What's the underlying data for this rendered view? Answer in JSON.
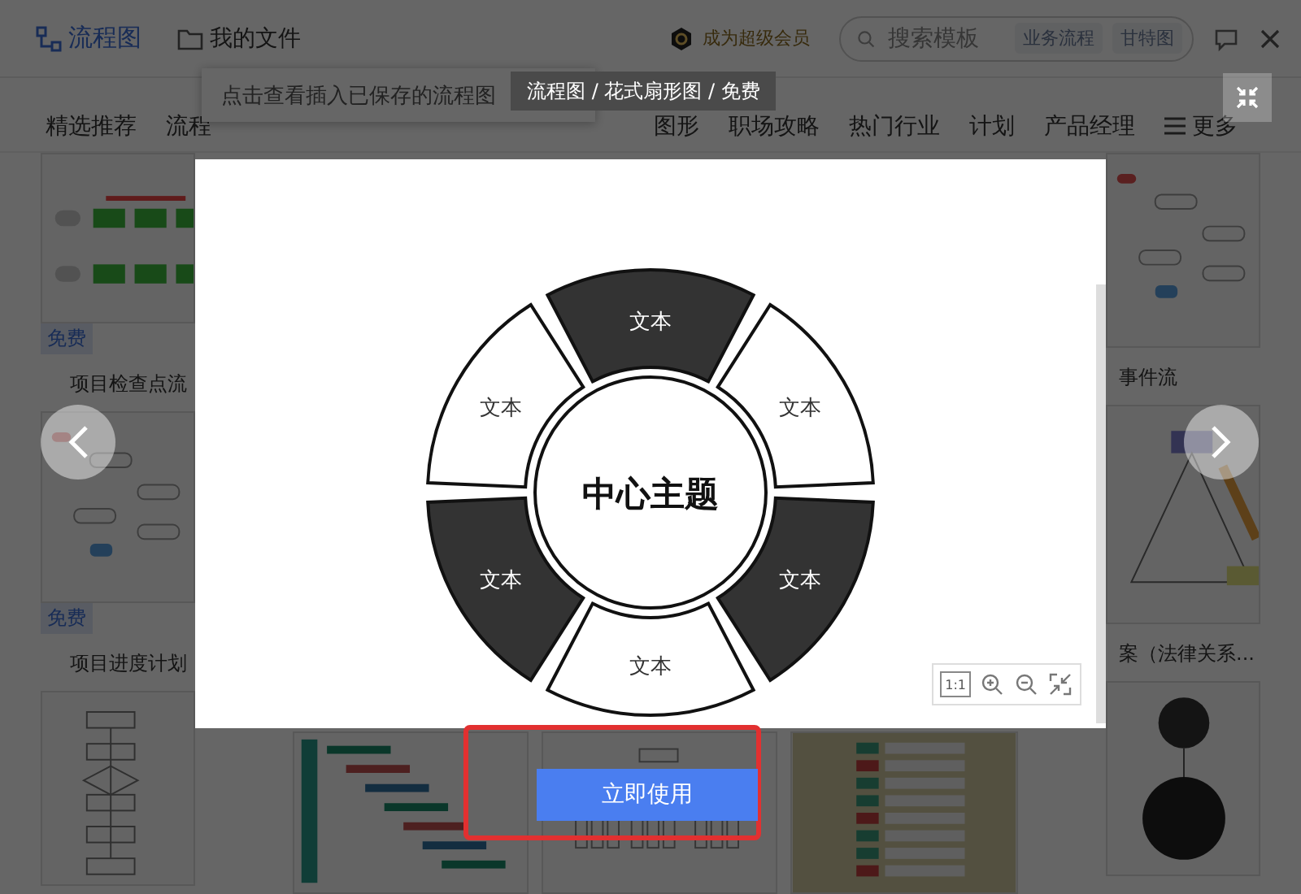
{
  "header": {
    "logo": "流程图",
    "my_files": "我的文件",
    "vip": "成为超级会员",
    "search": {
      "placeholder": "搜索模板",
      "tags": [
        "业务流程",
        "甘特图"
      ]
    }
  },
  "nav": {
    "items_left": [
      "精选推荐",
      "流程"
    ],
    "items_right": [
      "图形",
      "职场攻略",
      "热门行业",
      "计划",
      "产品经理"
    ],
    "more": "更多"
  },
  "tooltip": "点击查看插入已保存的流程图",
  "left_cards": [
    {
      "kind": "green-flow",
      "tag": "免费",
      "title": "项目检查点流"
    },
    {
      "kind": "loop-flow",
      "tag": "免费",
      "title": "项目进度计划"
    },
    {
      "kind": "vertical-flow"
    }
  ],
  "middle_cards": [
    {
      "kind": "gantt"
    },
    {
      "kind": "tree"
    },
    {
      "kind": "table"
    }
  ],
  "right_cards": [
    {
      "kind": "loop-flow",
      "title": "事件流"
    },
    {
      "kind": "triangle",
      "title": "案（法律关系..."
    },
    {
      "kind": "circles"
    }
  ],
  "preview": {
    "breadcrumb": "流程图 / 花式扇形图 / 免费",
    "diagram": {
      "center": "中心主题",
      "segments": [
        {
          "label": "文本",
          "kind": "dark"
        },
        {
          "label": "文本",
          "kind": "light"
        },
        {
          "label": "文本",
          "kind": "dark"
        },
        {
          "label": "文本",
          "kind": "light"
        },
        {
          "label": "文本",
          "kind": "dark"
        },
        {
          "label": "文本",
          "kind": "light"
        }
      ]
    },
    "zoom_tools": [
      {
        "kind": "actual-size",
        "label": "1:1"
      },
      {
        "kind": "zoom-in"
      },
      {
        "kind": "zoom-out"
      },
      {
        "kind": "fit"
      }
    ],
    "use_button": "立即使用"
  }
}
